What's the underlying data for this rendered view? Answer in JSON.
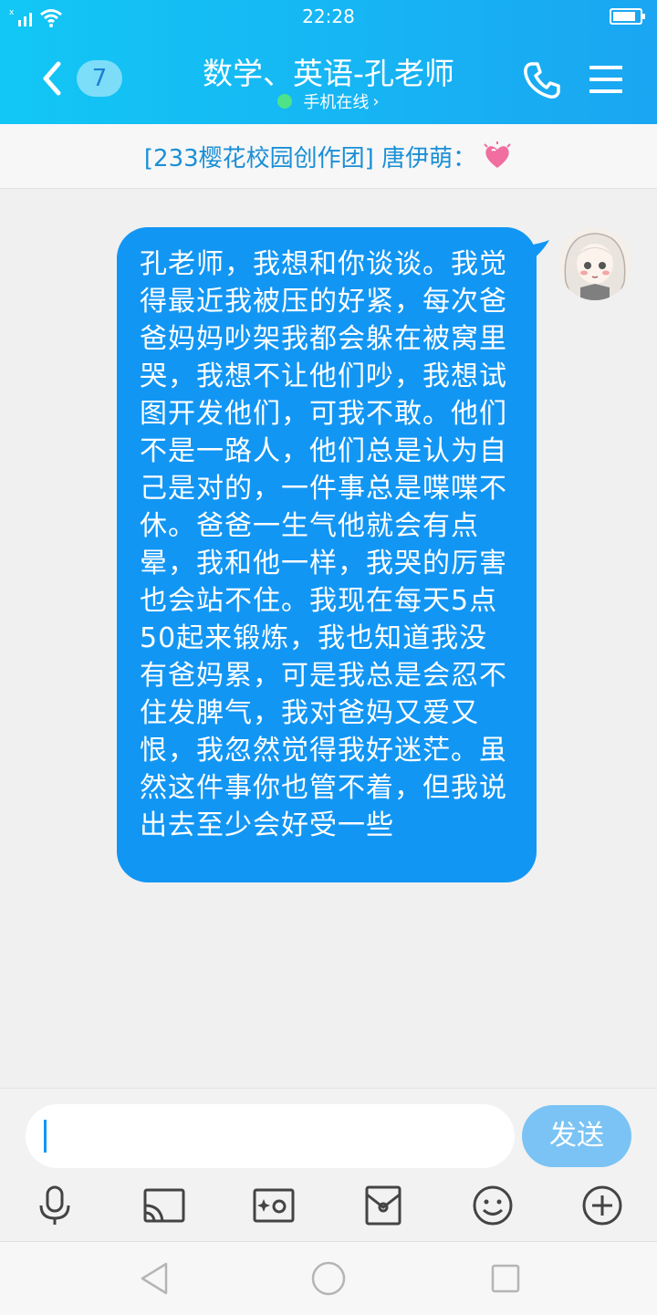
{
  "status_bar": {
    "time": "22:28"
  },
  "header": {
    "unread_count": "7",
    "title": "数学、英语-孔老师",
    "status": "手机在线",
    "status_chevron": "›"
  },
  "notice": {
    "text": "[233樱花校园创作团] 唐伊萌：",
    "icon": "sparkling-heart-icon"
  },
  "message": {
    "text": "孔老师，我想和你谈谈。我觉得最近我被压的好紧，每次爸爸妈妈吵架我都会躲在被窝里哭，我想不让他们吵，我想试图开发他们，可我不敢。他们不是一路人，他们总是认为自己是对的，一件事总是喋喋不休。爸爸一生气他就会有点晕，我和他一样，我哭的厉害也会站不住。我现在每天5点50起来锻炼，我也知道我没有爸妈累，可是我总是会忍不住发脾气，我对爸妈又爱又恨，我忽然觉得我好迷茫。虽然这件事你也管不着，但我说出去至少会好受一些"
  },
  "composer": {
    "send_label": "发送",
    "toolbar_icons": [
      "microphone-icon",
      "video-cast-icon",
      "photo-icon",
      "red-packet-icon",
      "emoji-icon",
      "plus-icon"
    ]
  },
  "colors": {
    "header_gradient_start": "#12c7f5",
    "header_gradient_end": "#1aa6f2",
    "bubble": "#1296f4",
    "send_button": "#7ac3f4",
    "notice_text": "#1a8fd6",
    "online_dot": "#4ee388"
  }
}
